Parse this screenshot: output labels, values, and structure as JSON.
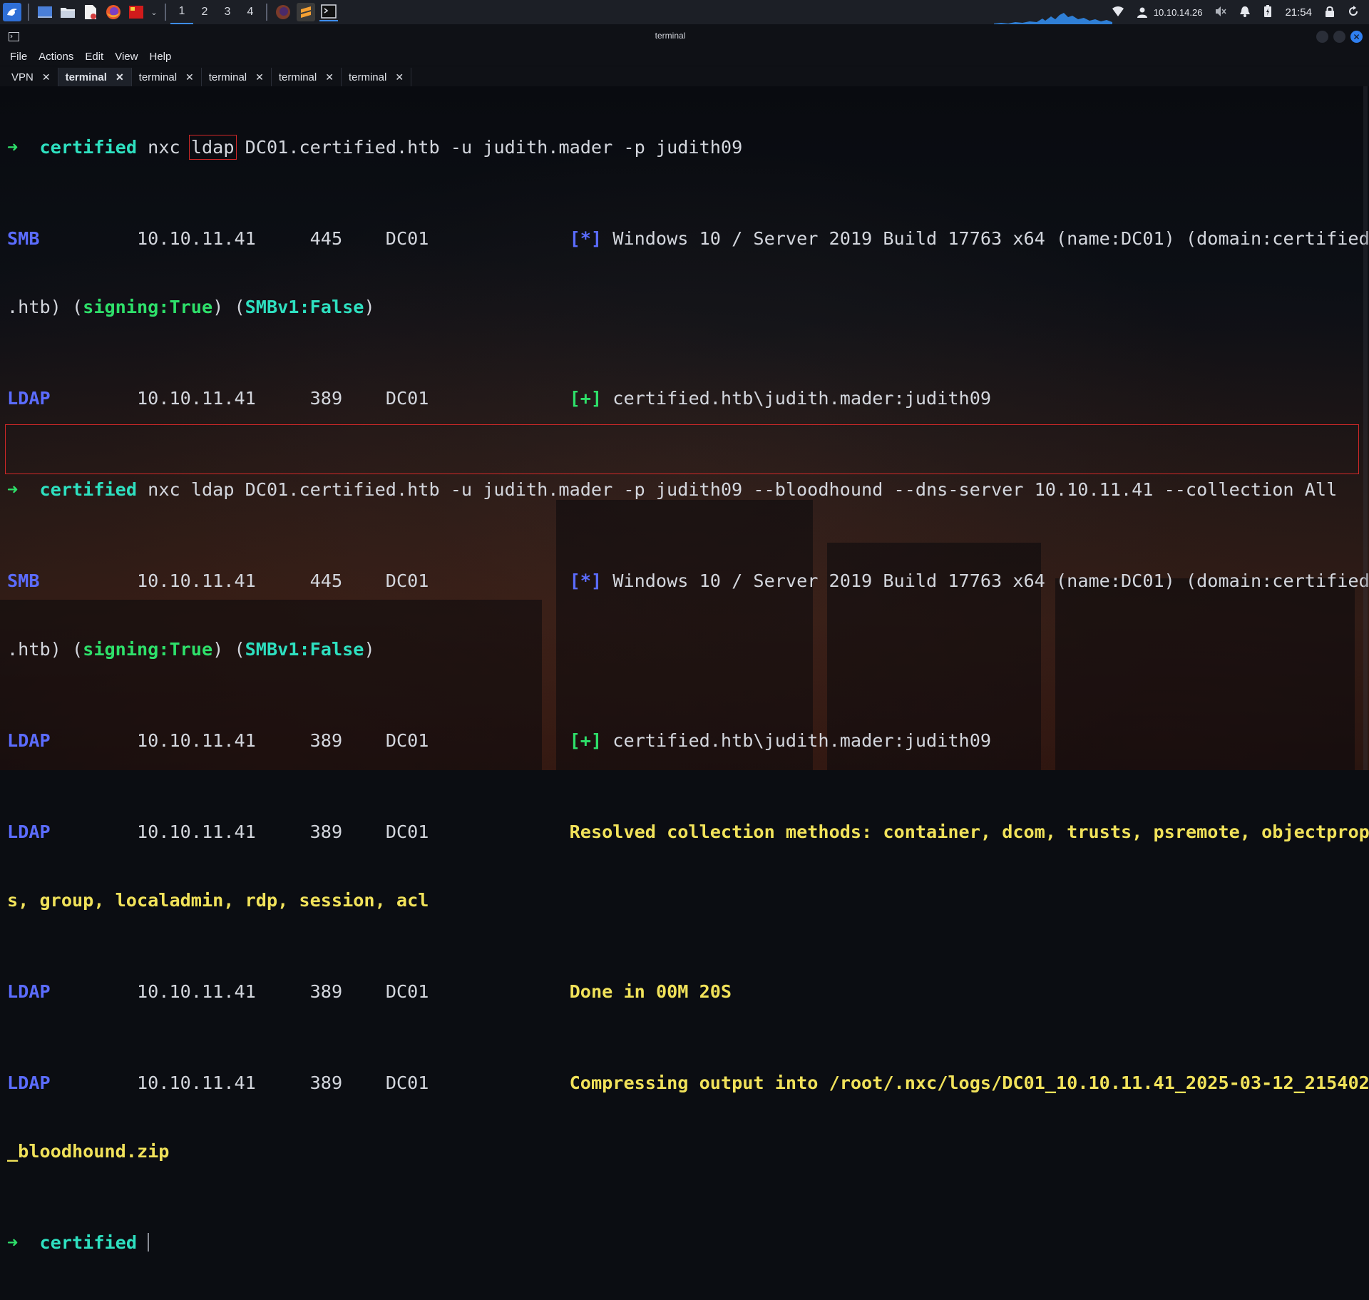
{
  "taskbar": {
    "workspaces": [
      "1",
      "2",
      "3",
      "4"
    ],
    "active_workspace": "1",
    "ip_address": "10.10.14.26",
    "clock": "21:54",
    "icons": [
      "kali-menu-icon",
      "desktop-icon",
      "file-manager-icon",
      "text-editor-icon",
      "firefox-icon",
      "red-app-icon",
      "firefox-icon",
      "sublime-icon",
      "terminal-icon"
    ]
  },
  "window": {
    "title": "terminal"
  },
  "menu": [
    "File",
    "Actions",
    "Edit",
    "View",
    "Help"
  ],
  "tabs": [
    {
      "label": "VPN",
      "active": false
    },
    {
      "label": "terminal",
      "active": true
    },
    {
      "label": "terminal",
      "active": false
    },
    {
      "label": "terminal",
      "active": false
    },
    {
      "label": "terminal",
      "active": false
    },
    {
      "label": "terminal",
      "active": false
    }
  ],
  "tab_close_glyph": "✕",
  "terminal": {
    "prompt_arrow": "➜",
    "prompt_dir": "certified",
    "cmd1_pre": "nxc ",
    "cmd1_hl": "ldap",
    "cmd1_post": " DC01.certified.htb -u judith.mader -p judith09",
    "cmd2": "nxc ldap DC01.certified.htb -u judith.mader -p judith09 --bloodhound --dns-server 10.10.11.41 --collection All",
    "smb_label": "SMB",
    "ldap_label": "LDAP",
    "ip": "10.10.11.41",
    "port_smb": "445",
    "port_ldap": "389",
    "host": "DC01",
    "star": "[*]",
    "plus": "[+]",
    "smb_info": " Windows 10 / Server 2019 Build 17763 x64 (name:DC01) (domain:certified",
    "smb_info_cont_pre": ".htb) (",
    "signing": "signing:True",
    "mid": ") (",
    "smbv1": "SMBv1:False",
    "close": ")",
    "auth": " certified.htb\\judith.mader:judith09",
    "resolved": "Resolved collection methods: container, dcom, trusts, psremote, objectprop",
    "resolved_cont": "s, group, localadmin, rdp, session, acl",
    "done": "Done in 00M 20S",
    "compress": "Compressing output into /root/.nxc/logs/DC01_10.10.11.41_2025-03-12_215402",
    "compress_cont": "_bloodhound.zip"
  },
  "colors": {
    "accent": "#3d8df5",
    "prompt_green": "#2ee06a",
    "dir_cyan": "#2ee0c0",
    "proto_blue": "#5b6cff",
    "yellow": "#f1e25a",
    "highlight_red": "#d02828"
  }
}
